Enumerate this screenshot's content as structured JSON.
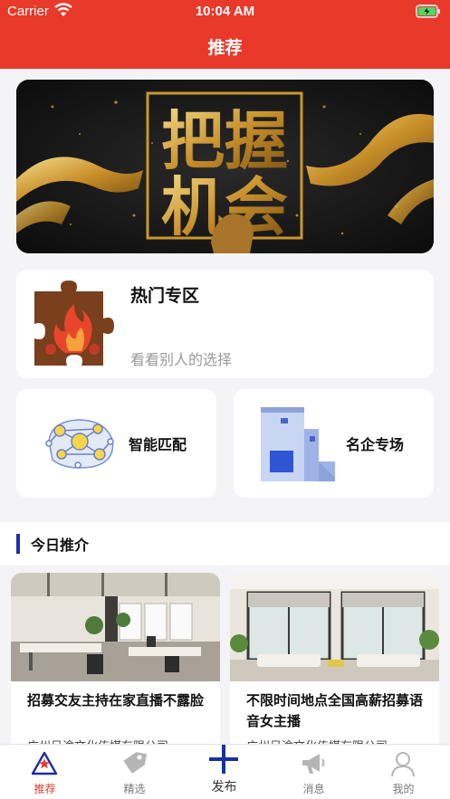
{
  "status_bar": {
    "carrier": "Carrier",
    "time": "10:04 AM"
  },
  "nav": {
    "title": "推荐"
  },
  "banner": {
    "line1": "把握",
    "line2": "机会"
  },
  "hot_zone": {
    "title": "热门专区",
    "subtitle": "看看别人的选择"
  },
  "features": [
    {
      "label": "智能匹配",
      "icon": "network-icon"
    },
    {
      "label": "名企专场",
      "icon": "building-icon"
    }
  ],
  "today": {
    "title": "今日推介"
  },
  "jobs": [
    {
      "title": "招募交友主持在家直播不露脸",
      "company": "广州呈途文化传媒有限公司"
    },
    {
      "title": "不限时间地点全国高薪招募语音女主播",
      "company": "广州呈途文化传媒有限公司"
    }
  ],
  "tabs": [
    {
      "label": "推荐",
      "icon": "recommend-icon",
      "active": true
    },
    {
      "label": "精选",
      "icon": "tag-icon",
      "active": false
    },
    {
      "label": "发布",
      "icon": "plus-icon",
      "active": false
    },
    {
      "label": "消息",
      "icon": "megaphone-icon",
      "active": false
    },
    {
      "label": "我的",
      "icon": "user-icon",
      "active": false
    }
  ],
  "colors": {
    "brand_red": "#e8392a",
    "accent_blue": "#1a2fa0",
    "gold": "#d4a43a"
  }
}
